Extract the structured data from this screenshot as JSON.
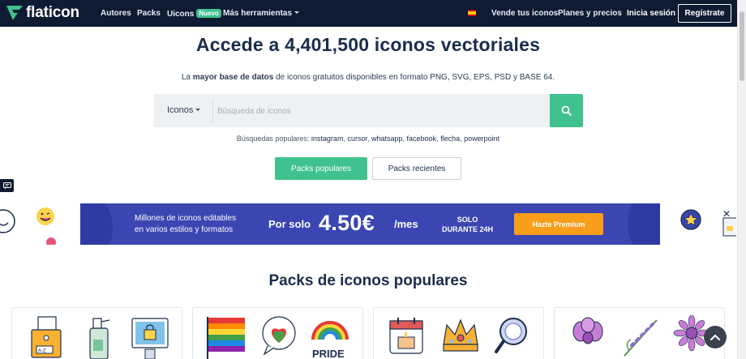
{
  "header": {
    "logo_text": "flaticon",
    "nav": [
      "Autores",
      "Packs",
      "Uicons",
      "Más herramientas"
    ],
    "uicons_badge": "Nuevo",
    "sell": "Vende tus iconos",
    "plans": "Planes y precios",
    "login": "Inicia sesión",
    "signup": "Regístrate"
  },
  "hero": {
    "title": "Accede a 4,401,500 iconos vectoriales",
    "subtitle_pre": "La ",
    "subtitle_bold": "mayor base de datos",
    "subtitle_post": " de iconos gratuitos disponibles en formato PNG, SVG, EPS, PSD y BASE 64."
  },
  "search": {
    "type_label": "Iconos",
    "placeholder": "Búsqueda de iconos",
    "value": ""
  },
  "popular": {
    "label": "Búsquedas populares:",
    "terms": [
      "instagram",
      "cursor",
      "whatsapp",
      "facebook",
      "flecha",
      "powerpoint"
    ]
  },
  "buttons": {
    "popular_packs": "Packs populares",
    "recent_packs": "Packs recientes"
  },
  "banner": {
    "line1": "Millones de iconos editables",
    "line2": "en varios estilos y formatos",
    "por_solo": "Por solo",
    "price": "4.50€",
    "per": "/mes",
    "solo1": "SOLO",
    "solo2": "DURANTE 24H",
    "cta": "Hazte Premium",
    "close": "✕"
  },
  "packs": {
    "title": "Packs de iconos populares",
    "pride_text": "PRIDE"
  },
  "colors": {
    "header_bg": "#0e1b33",
    "brand_green": "#3fc28f",
    "banner_blue": "#3b46b3",
    "cta_orange": "#f89e1b"
  }
}
